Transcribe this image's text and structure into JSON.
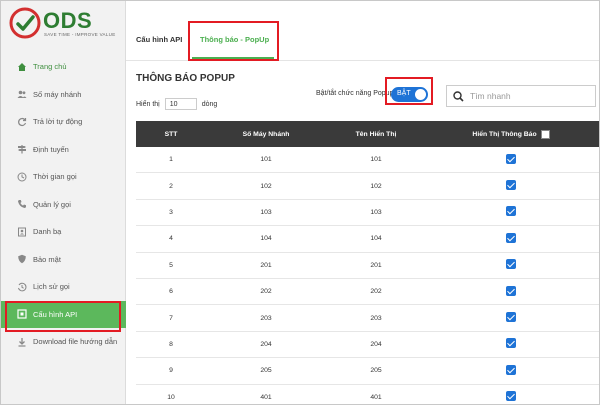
{
  "brand": {
    "name": "ODS",
    "tagline": "SAVE TIME - IMPROVE VALUE",
    "colors": {
      "green": "#2e7d32",
      "red": "#d32f2f",
      "accent": "#4caf50",
      "blue": "#1e73d6",
      "highlight": "#e31b23"
    }
  },
  "sidebar": {
    "items": [
      {
        "label": "Trang chủ",
        "icon": "home-icon"
      },
      {
        "label": "Số máy nhánh",
        "icon": "users-icon"
      },
      {
        "label": "Trả lời tự động",
        "icon": "refresh-icon"
      },
      {
        "label": "Định tuyến",
        "icon": "signpost-icon"
      },
      {
        "label": "Thời gian gọi",
        "icon": "clock-icon"
      },
      {
        "label": "Quản lý gọi",
        "icon": "phone-icon"
      },
      {
        "label": "Danh bạ",
        "icon": "contacts-icon"
      },
      {
        "label": "Bảo mật",
        "icon": "shield-icon"
      },
      {
        "label": "Lịch sử gọi",
        "icon": "history-icon"
      },
      {
        "label": "Cấu hình API",
        "icon": "api-icon"
      },
      {
        "label": "Download file hướng dẫn",
        "icon": "download-icon"
      }
    ],
    "active_index": 9
  },
  "tabs": [
    {
      "label": "Cấu hình API"
    },
    {
      "label": "Thông báo - PopUp"
    }
  ],
  "page": {
    "title": "THÔNG BÁO POPUP",
    "show_prefix": "Hiển thị",
    "show_count": "10",
    "show_suffix": "dòng",
    "toggle_label": "Bật/tắt chức năng Popup",
    "toggle_state": "BẬT",
    "search_placeholder": "Tìm nhanh"
  },
  "table": {
    "headers": [
      "STT",
      "Số Máy Nhánh",
      "Tên Hiển Thị",
      "Hiển Thị Thông Báo"
    ],
    "rows": [
      {
        "stt": "1",
        "ext": "101",
        "name": "101",
        "checked": true
      },
      {
        "stt": "2",
        "ext": "102",
        "name": "102",
        "checked": true
      },
      {
        "stt": "3",
        "ext": "103",
        "name": "103",
        "checked": true
      },
      {
        "stt": "4",
        "ext": "104",
        "name": "104",
        "checked": true
      },
      {
        "stt": "5",
        "ext": "201",
        "name": "201",
        "checked": true
      },
      {
        "stt": "6",
        "ext": "202",
        "name": "202",
        "checked": true
      },
      {
        "stt": "7",
        "ext": "203",
        "name": "203",
        "checked": true
      },
      {
        "stt": "8",
        "ext": "204",
        "name": "204",
        "checked": true
      },
      {
        "stt": "9",
        "ext": "205",
        "name": "205",
        "checked": true
      },
      {
        "stt": "10",
        "ext": "401",
        "name": "401",
        "checked": true
      }
    ]
  }
}
